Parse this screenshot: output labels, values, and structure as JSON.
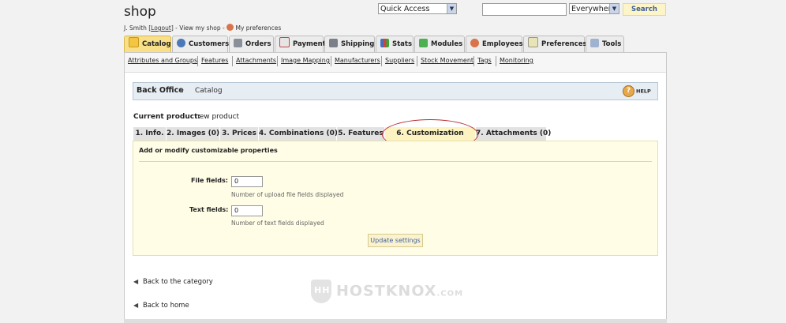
{
  "header": {
    "shop_name": "shop",
    "user_name": "J. Smith",
    "logout_label": "Logout",
    "view_shop_label": "View my shop",
    "preferences_label": "My preferences"
  },
  "search": {
    "scope_selector": "Quick Access",
    "query": "",
    "location": "Everywhere",
    "button_label": "Search"
  },
  "tabs": [
    {
      "label": "Catalog",
      "icon": "folder-icon",
      "active": true
    },
    {
      "label": "Customers",
      "icon": "user-icon"
    },
    {
      "label": "Orders",
      "icon": "cart-icon"
    },
    {
      "label": "Payment",
      "icon": "payment-icon"
    },
    {
      "label": "Shipping",
      "icon": "truck-icon"
    },
    {
      "label": "Stats",
      "icon": "chart-icon"
    },
    {
      "label": "Modules",
      "icon": "puzzle-icon"
    },
    {
      "label": "Employees",
      "icon": "employee-icon"
    },
    {
      "label": "Preferences",
      "icon": "preferences-icon"
    },
    {
      "label": "Tools",
      "icon": "wrench-icon"
    }
  ],
  "subnav": [
    "Attributes and Groups",
    "Features",
    "Attachments",
    "Image Mapping",
    "Manufacturers",
    "Suppliers",
    "Stock Movement",
    "Tags",
    "Monitoring"
  ],
  "breadcrumb": {
    "home": "Back Office",
    "current": "Catalog",
    "help_label": "HELP"
  },
  "product": {
    "current_label": "Current product:",
    "current_value": "new product"
  },
  "product_tabs": [
    "1. Info.",
    "2. Images (0)",
    "3. Prices",
    "4. Combinations (0)",
    "5. Features",
    "6. Customization",
    "7. Attachments (0)"
  ],
  "customization": {
    "heading": "Add or modify customizable properties",
    "file_fields_label": "File fields:",
    "file_fields_value": "0",
    "file_fields_hint": "Number of upload file fields displayed",
    "text_fields_label": "Text fields:",
    "text_fields_value": "0",
    "text_fields_hint": "Number of text fields displayed",
    "update_button": "Update settings"
  },
  "links": {
    "back_category": "Back to the category",
    "back_home": "Back to home"
  },
  "watermark": {
    "brand": "HOSTKNOX",
    "suffix": ".COM",
    "monogram": "HH"
  },
  "colors": {
    "active_tab": "#f8e08a",
    "panel_bg": "#fffde6",
    "breadcrumb_bg": "#e6edf3",
    "highlight_ring": "#b83030",
    "link_blue": "#3f5f9a"
  }
}
